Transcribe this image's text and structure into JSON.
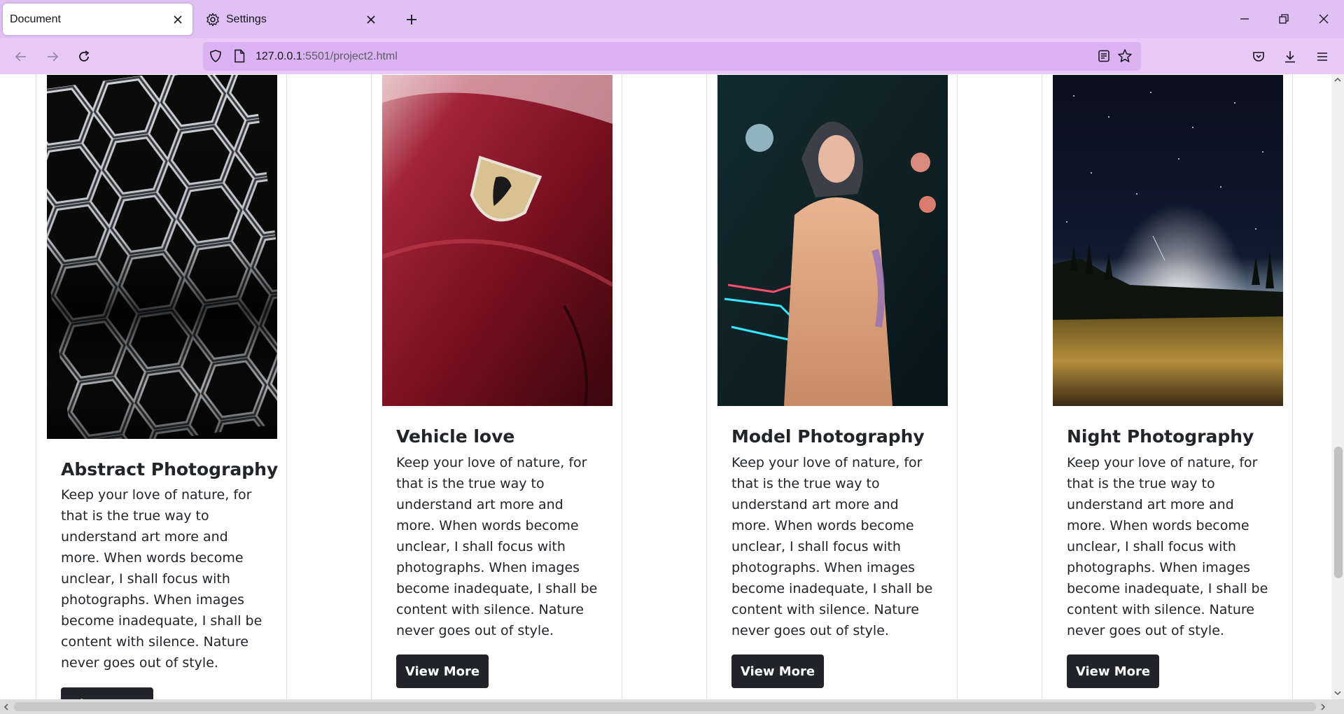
{
  "browser": {
    "tabs": [
      {
        "title": "Document",
        "active": true
      },
      {
        "title": "Settings",
        "active": false,
        "icon": "gear-icon"
      }
    ],
    "url": {
      "host": "127.0.0.1",
      "path": ":5501/project2.html"
    },
    "colors": {
      "tabbar": "#e1c1f5",
      "navbar": "#e8c9f7",
      "urlbar": "#dcb3f2"
    }
  },
  "cards": [
    {
      "title": "Abstract Photography",
      "text": "Keep your love of nature, for that is the true way to understand art more and more. When words become unclear, I shall focus with photographs. When images become inadequate, I shall be content with silence. Nature never goes out of style.",
      "button": "View More",
      "image": "abstract-hexagon-structure"
    },
    {
      "title": "Vehicle love",
      "text": "Keep your love of nature, for that is the true way to understand art more and more. When words become unclear, I shall focus with photographs. When images become inadequate, I shall be content with silence. Nature never goes out of style.",
      "button": "View More",
      "image": "red-car-emblem"
    },
    {
      "title": "Model Photography",
      "text": "Keep your love of nature, for that is the true way to understand art more and more. When words become unclear, I shall focus with photographs. When images become inadequate, I shall be content with silence. Nature never goes out of style.",
      "button": "View More",
      "image": "neon-portrait"
    },
    {
      "title": "Night Photography",
      "text": "Keep your love of nature, for that is the true way to understand art more and more. When words become unclear, I shall focus with photographs. When images become inadequate, I shall be content with silence. Nature never goes out of style.",
      "button": "View More",
      "image": "starry-night-landscape"
    }
  ]
}
